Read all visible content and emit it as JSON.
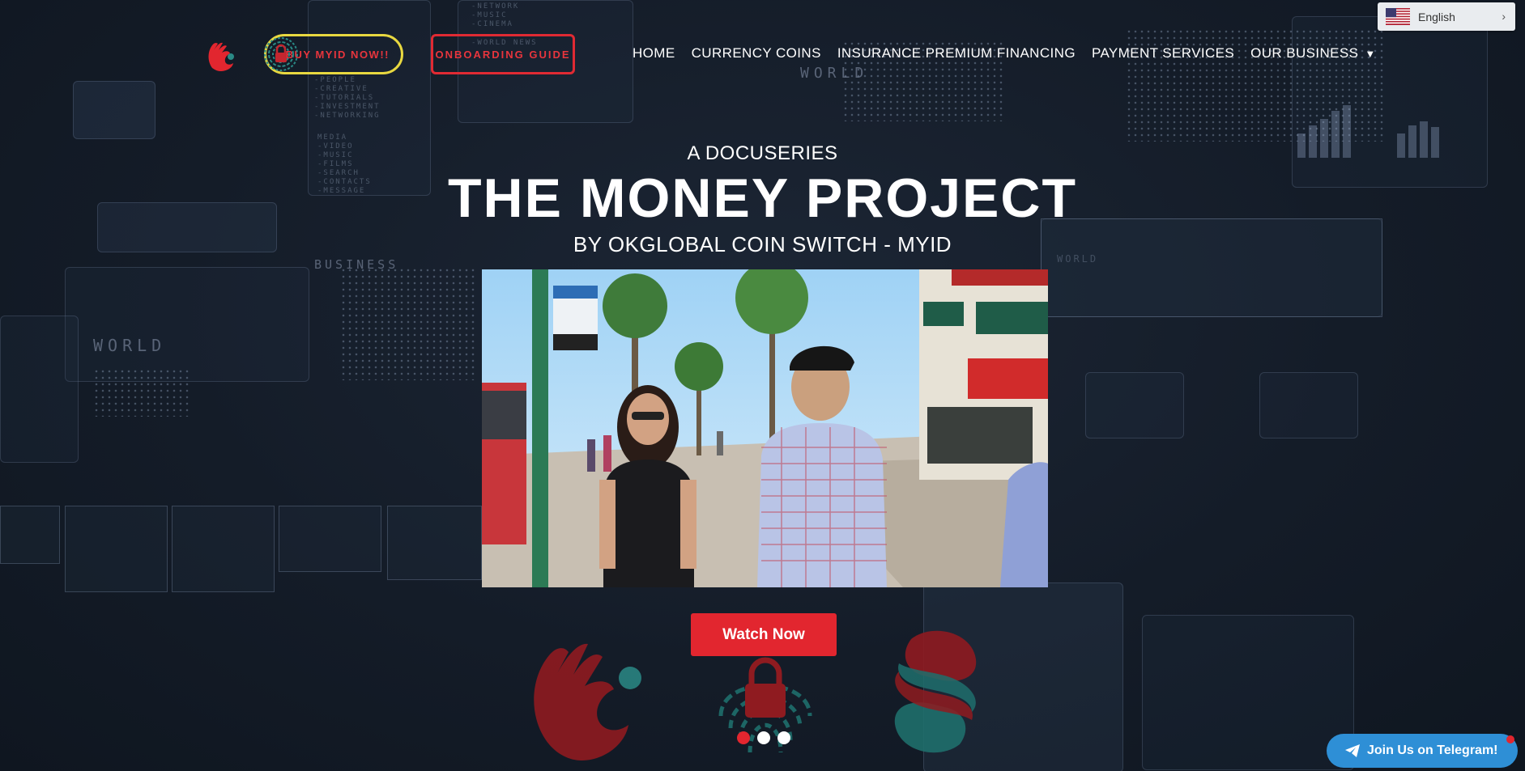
{
  "header": {
    "buy_button": "BUY MYID NOW!!",
    "onboarding_button": "ONBOARDING GUIDE",
    "nav": {
      "home": "HOME",
      "currency_coins": "CURRENCY COINS",
      "insurance": "INSURANCE PREMIUM FINANCING",
      "payment": "PAYMENT SERVICES",
      "our_business": "OUR BUSINESS"
    },
    "nav_caret_icon": "caret-down-icon"
  },
  "language": {
    "label": "English",
    "flag_icon": "us-flag-icon",
    "chevron": "›"
  },
  "hero": {
    "eyebrow": "A DOCUSERIES",
    "title": "THE MONEY PROJECT",
    "subtitle": "BY OKGLOBAL COIN SWITCH - MYID",
    "video_thumbnail": "video-thumbnail-two-people-street",
    "watch_button": "Watch Now"
  },
  "background_text": {
    "world": "WORLD",
    "business": "BUSINESS",
    "media_list": "MEDIA\n-VIDEO\n-MUSIC\n-FILMS\n-SEARCH\n-CONTACTS\n-MESSAGE",
    "network_list": "-NETWORK\n-MUSIC\n-CINEMA",
    "world_news": "-WORLD NEWS",
    "people_list": "-PEOPLE\n-CREATIVE\n-TUTORIALS\n-INVESTMENT\n-NETWORKING"
  },
  "carousel": {
    "slides": 3,
    "active_index": 0
  },
  "telegram": {
    "label": "Join Us on Telegram!",
    "icon": "telegram-plane-icon"
  },
  "colors": {
    "accent_red": "#e2262f",
    "accent_yellow": "#e8d840",
    "teal": "#2a8a86",
    "telegram_blue": "#2e8fd6",
    "background": "#121a26"
  }
}
